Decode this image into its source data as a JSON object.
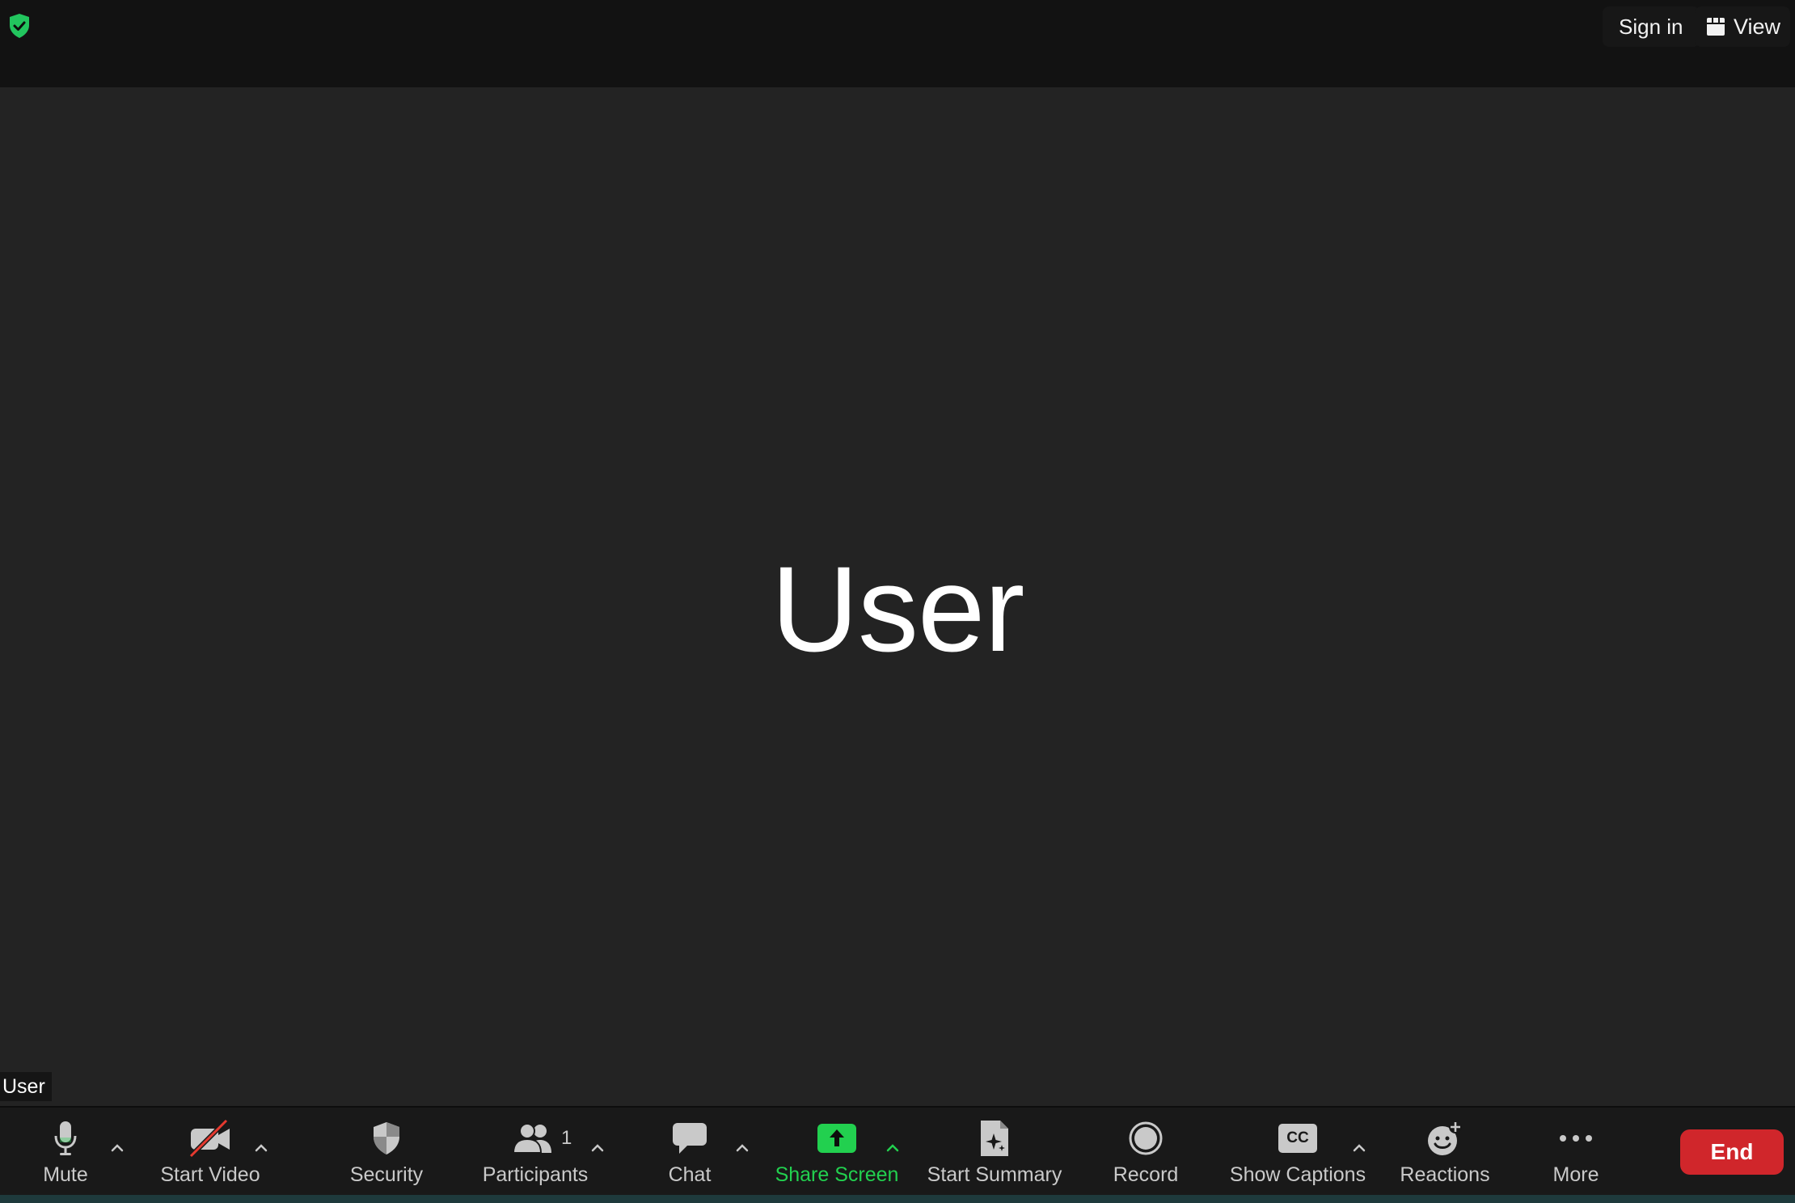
{
  "topbar": {
    "signin_label": "Sign in",
    "view_label": "View",
    "security_color": "#22c55e"
  },
  "stage": {
    "display_name": "User",
    "name_tag": "User"
  },
  "toolbar": {
    "mute": "Mute",
    "start_video": "Start Video",
    "security": "Security",
    "participants": "Participants",
    "participants_count": "1",
    "chat": "Chat",
    "share_screen": "Share Screen",
    "start_summary": "Start Summary",
    "record": "Record",
    "show_captions": "Show Captions",
    "captions_icon_text": "CC",
    "reactions": "Reactions",
    "more": "More",
    "end": "End"
  },
  "colors": {
    "share_green": "#22d04f",
    "end_red": "#d0262b",
    "video_off_slash": "#e5392f"
  }
}
